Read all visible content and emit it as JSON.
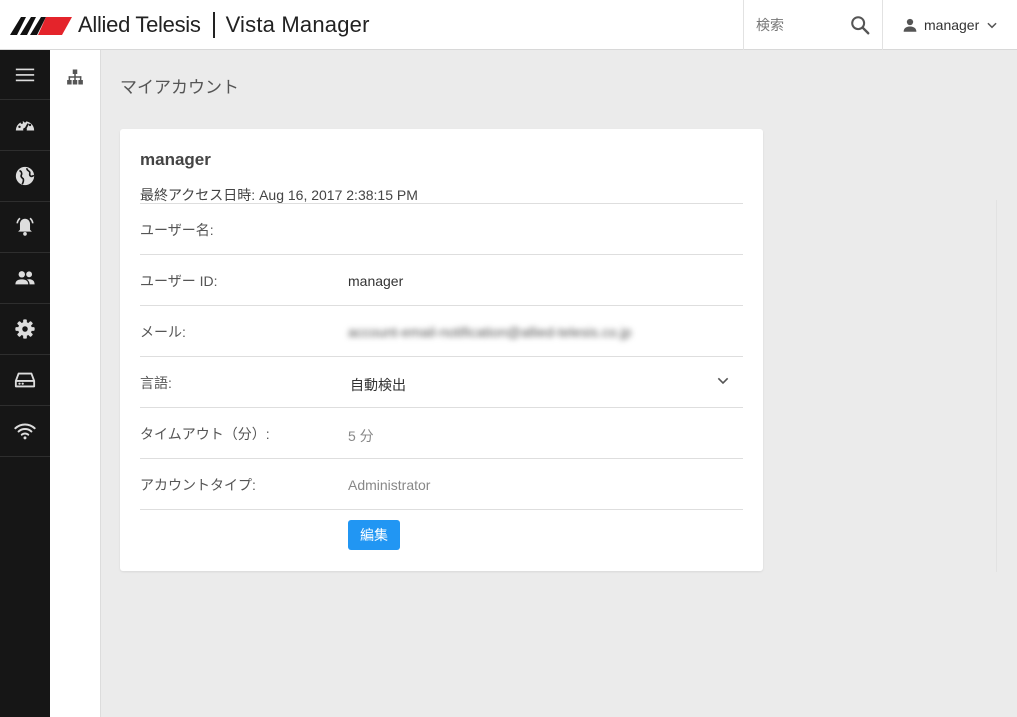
{
  "header": {
    "brand": "Allied Telesis",
    "product": "Vista Manager",
    "search_placeholder": "検索",
    "user_name": "manager"
  },
  "sidebar": {
    "items": [
      {
        "icon": "menu-icon"
      },
      {
        "icon": "dashboard-icon"
      },
      {
        "icon": "globe-icon"
      },
      {
        "icon": "alarm-icon"
      },
      {
        "icon": "users-icon"
      },
      {
        "icon": "gear-icon"
      },
      {
        "icon": "storage-icon"
      },
      {
        "icon": "wifi-icon"
      }
    ]
  },
  "subpanel": {
    "icon": "sitemap-icon"
  },
  "page": {
    "title": "マイアカウント"
  },
  "account": {
    "name": "manager",
    "last_access": "最終アクセス日時: Aug 16, 2017 2:38:15 PM",
    "fields": {
      "username_label": "ユーザー名:",
      "userid_label": "ユーザー ID:",
      "userid_value": "manager",
      "email_label": "メール:",
      "email_value": "account-email-notification@allied-telesis.co.jp",
      "language_label": "言語:",
      "language_value": "自動検出",
      "timeout_label": "タイムアウト（分）:",
      "timeout_value": "5 分",
      "account_type_label": "アカウントタイプ:",
      "account_type_value": "Administrator"
    },
    "edit_button": "編集"
  },
  "colors": {
    "accent": "#2196f3",
    "sidebar_bg": "#161616",
    "background": "#ebebeb"
  }
}
